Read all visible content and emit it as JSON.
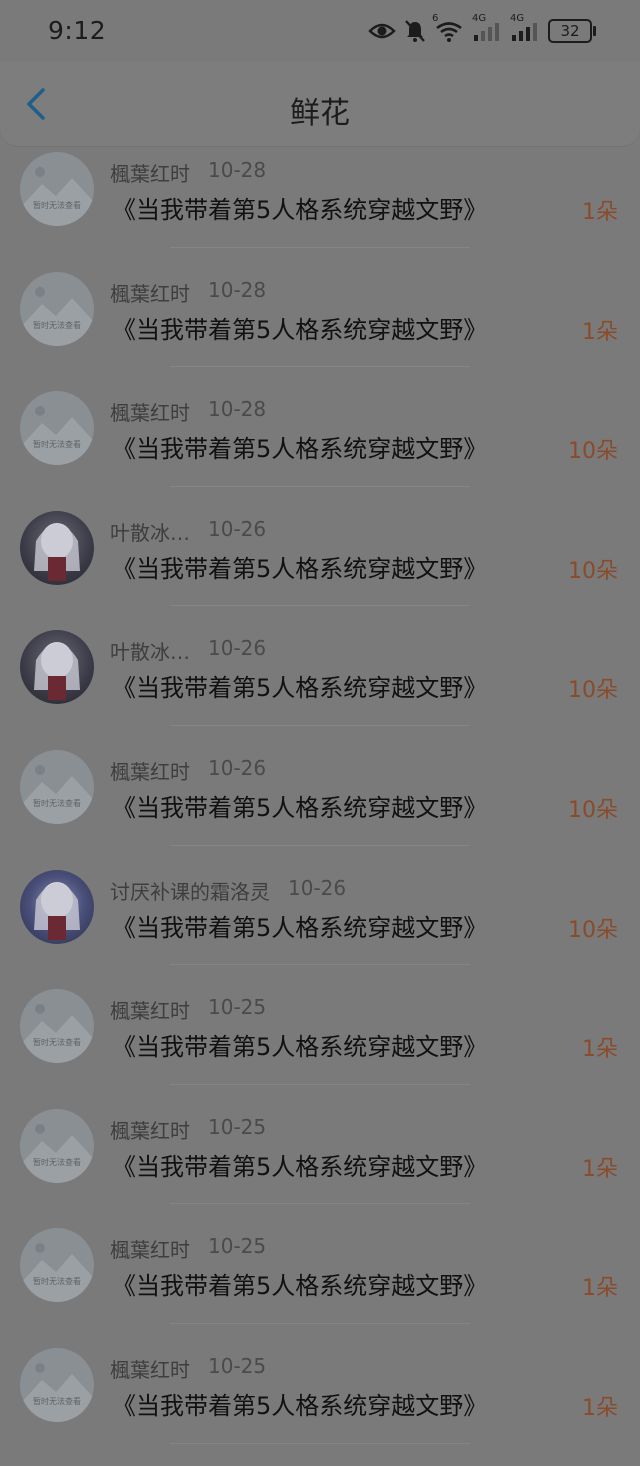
{
  "status_bar": {
    "time": "9:12",
    "network_left": "4G",
    "network_right": "4G",
    "wifi_badge": "6",
    "battery": "32"
  },
  "header": {
    "title": "鲜花",
    "back_icon": "chevron-left-icon",
    "accent_color": "#1f5f8a"
  },
  "placeholder_text": "暂时无法查看",
  "records": [
    {
      "user": "楓葉红时",
      "date": "10-28",
      "book": "《当我带着第5人格系统穿越文野》",
      "amount": "1朵",
      "avatar": "placeholder"
    },
    {
      "user": "楓葉红时",
      "date": "10-28",
      "book": "《当我带着第5人格系统穿越文野》",
      "amount": "1朵",
      "avatar": "placeholder"
    },
    {
      "user": "楓葉红时",
      "date": "10-28",
      "book": "《当我带着第5人格系统穿越文野》",
      "amount": "10朵",
      "avatar": "placeholder"
    },
    {
      "user": "叶散冰…",
      "date": "10-26",
      "book": "《当我带着第5人格系统穿越文野》",
      "amount": "10朵",
      "avatar": "anime"
    },
    {
      "user": "叶散冰…",
      "date": "10-26",
      "book": "《当我带着第5人格系统穿越文野》",
      "amount": "10朵",
      "avatar": "anime"
    },
    {
      "user": "楓葉红时",
      "date": "10-26",
      "book": "《当我带着第5人格系统穿越文野》",
      "amount": "10朵",
      "avatar": "placeholder"
    },
    {
      "user": "讨厌补课的霜洛灵",
      "date": "10-26",
      "book": "《当我带着第5人格系统穿越文野》",
      "amount": "10朵",
      "avatar": "anime2"
    },
    {
      "user": "楓葉红时",
      "date": "10-25",
      "book": "《当我带着第5人格系统穿越文野》",
      "amount": "1朵",
      "avatar": "placeholder"
    },
    {
      "user": "楓葉红时",
      "date": "10-25",
      "book": "《当我带着第5人格系统穿越文野》",
      "amount": "1朵",
      "avatar": "placeholder"
    },
    {
      "user": "楓葉红时",
      "date": "10-25",
      "book": "《当我带着第5人格系统穿越文野》",
      "amount": "1朵",
      "avatar": "placeholder"
    },
    {
      "user": "楓葉红时",
      "date": "10-25",
      "book": "《当我带着第5人格系统穿越文野》",
      "amount": "1朵",
      "avatar": "placeholder"
    }
  ]
}
